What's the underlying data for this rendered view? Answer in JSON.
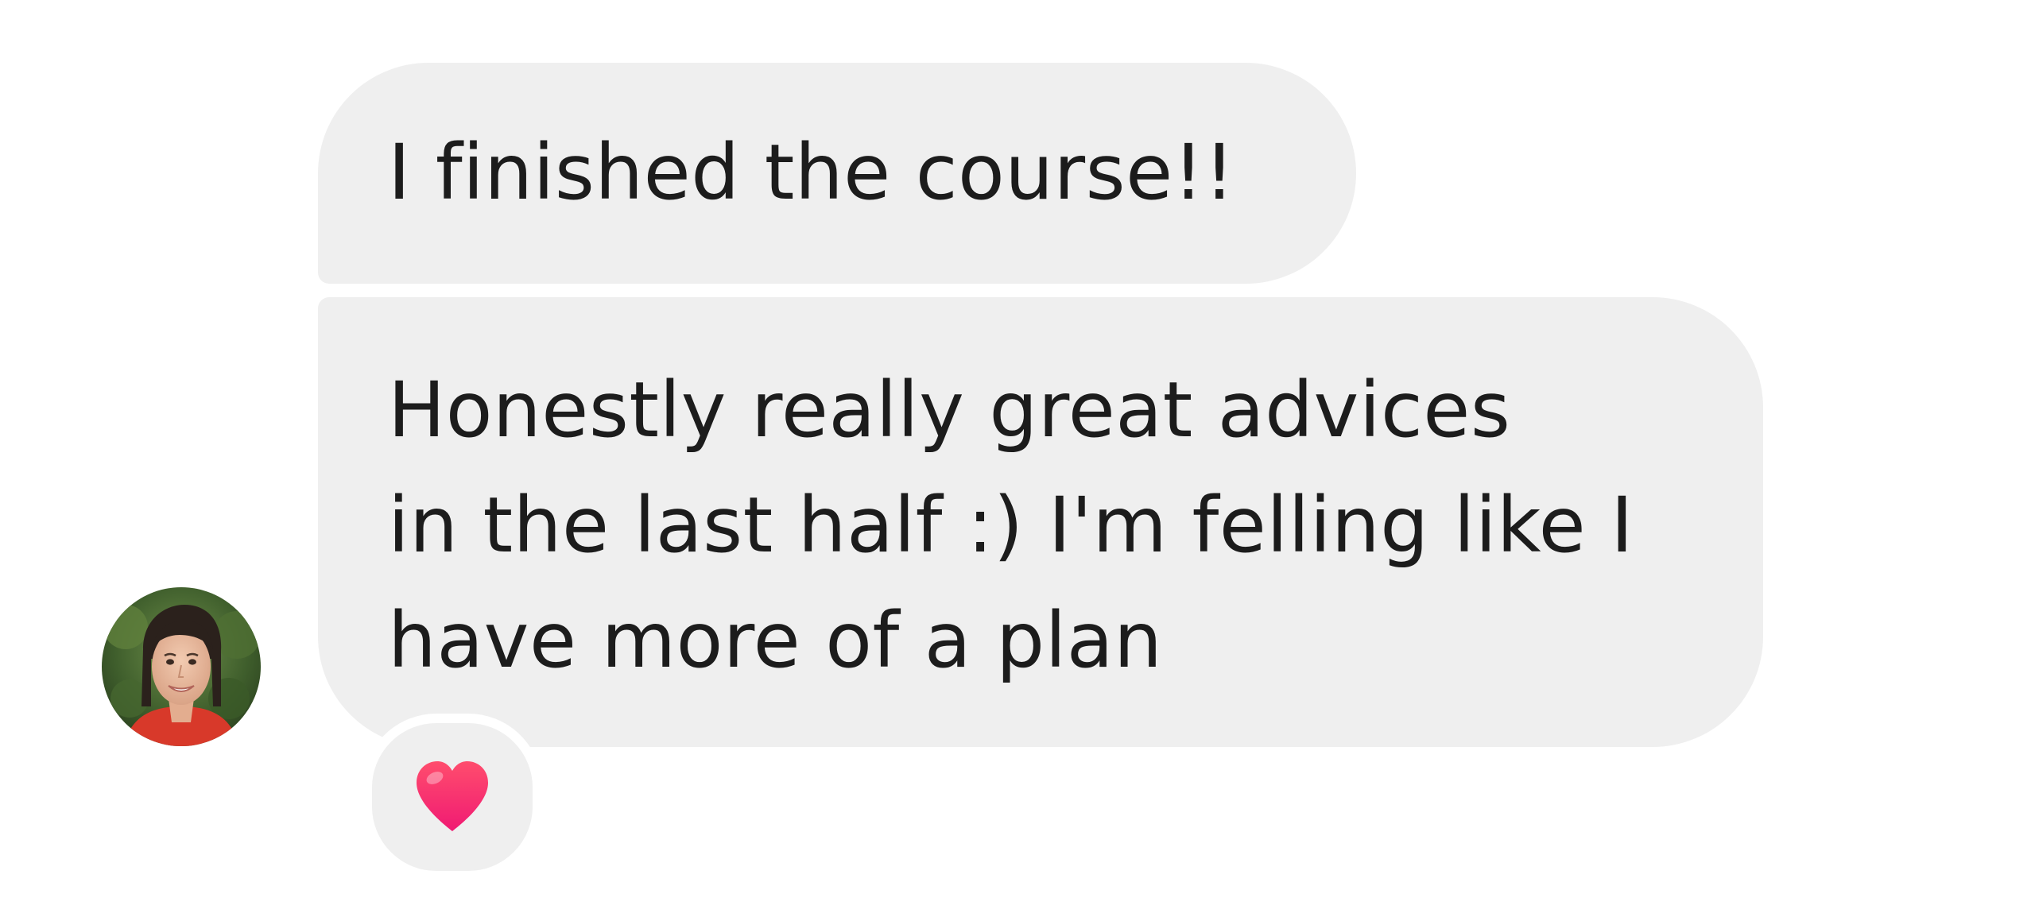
{
  "messages": [
    {
      "text": "I finished the course!!"
    },
    {
      "lines": [
        "Honestly really great advices",
        "in the last half :) I'm felling like I",
        "have more of a plan"
      ]
    }
  ],
  "sender": {
    "avatar_icon": "person-photo-avatar"
  },
  "reaction": {
    "icon": "red-heart-icon",
    "color": "#ff2f66"
  },
  "colors": {
    "bubble_background": "#efefef",
    "text": "#1c1c1c",
    "background": "#ffffff"
  }
}
